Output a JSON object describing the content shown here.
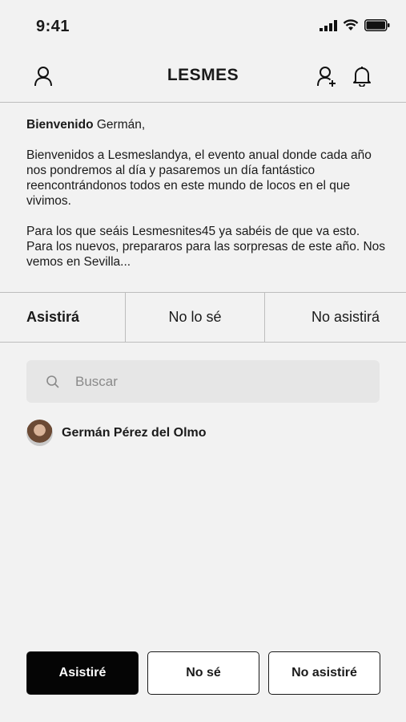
{
  "status_bar": {
    "time": "9:41"
  },
  "header": {
    "title": "LESMES"
  },
  "welcome": {
    "greeting_bold": "Bienvenido",
    "greeting_name": " Germán,",
    "paragraph_1": "Bienvenidos a Lesmeslandya, el evento anual donde cada año nos pondremos al día y pasaremos un día fantástico reencontrándonos todos en este mundo de locos en el que vivimos.",
    "paragraph_2": "Para los que seáis Lesmesnites45 ya sabéis de que va esto. Para los nuevos, prepararos para las sorpresas de este año. Nos vemos en Sevilla..."
  },
  "tabs": [
    {
      "label": "Asistirá",
      "active": true
    },
    {
      "label": "No lo sé",
      "active": false
    },
    {
      "label": "No asistirá",
      "active": false
    }
  ],
  "search": {
    "placeholder": "Buscar",
    "value": ""
  },
  "attendees": [
    {
      "name": "Germán Pérez del Olmo"
    }
  ],
  "actions": {
    "attend": "Asistiré",
    "unsure": "No sé",
    "not_attend": "No asistiré"
  },
  "colors": {
    "background": "#f2f2f2",
    "primary_button": "#050505",
    "search_bg": "#e6e6e6"
  }
}
